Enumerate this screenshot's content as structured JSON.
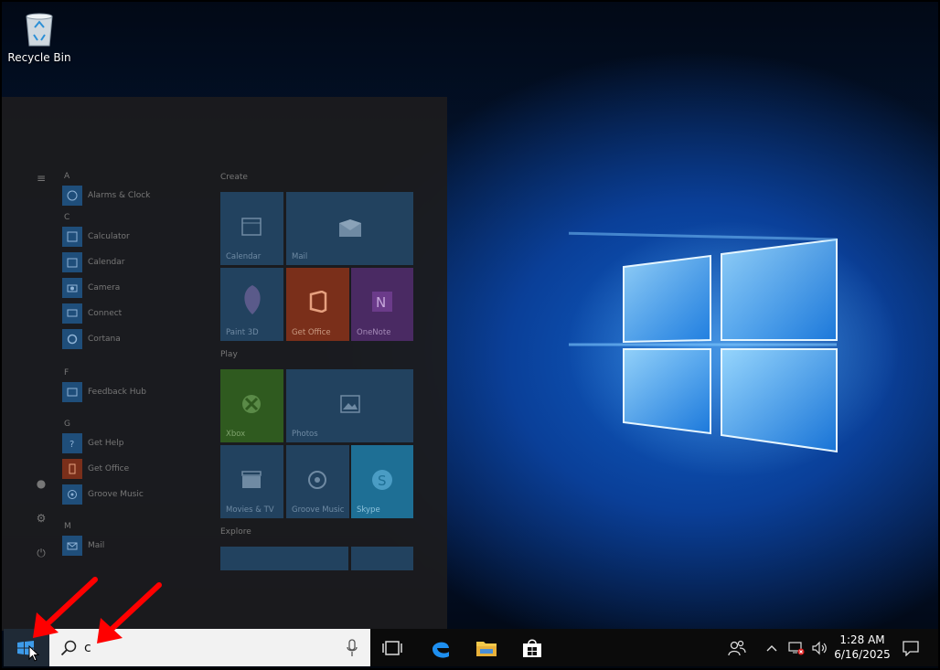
{
  "desktop": {
    "recycle_bin_label": "Recycle Bin"
  },
  "start_menu": {
    "letters": [
      "A",
      "C",
      "F",
      "G",
      "M"
    ],
    "apps": [
      {
        "letter": "A",
        "label": "Alarms & Clock",
        "icon": "alarm-clock-icon"
      },
      {
        "letter": "C",
        "label": "Calculator",
        "icon": "calculator-icon"
      },
      {
        "letter": "C",
        "label": "Calendar",
        "icon": "calendar-icon"
      },
      {
        "letter": "C",
        "label": "Camera",
        "icon": "camera-icon"
      },
      {
        "letter": "C",
        "label": "Connect",
        "icon": "connect-icon"
      },
      {
        "letter": "C",
        "label": "Cortana",
        "icon": "cortana-icon"
      },
      {
        "letter": "F",
        "label": "Feedback Hub",
        "icon": "feedback-icon"
      },
      {
        "letter": "G",
        "label": "Get Help",
        "icon": "help-icon"
      },
      {
        "letter": "G",
        "label": "Get Office",
        "icon": "office-icon"
      },
      {
        "letter": "G",
        "label": "Groove Music",
        "icon": "groove-icon"
      },
      {
        "letter": "M",
        "label": "Mail",
        "icon": "mail-icon"
      }
    ],
    "sections": {
      "create": "Create",
      "play": "Play",
      "explore": "Explore"
    },
    "tiles": {
      "calendar": "Calendar",
      "mail": "Mail",
      "paint3d": "Paint 3D",
      "get_office": "Get Office",
      "onenote": "OneNote",
      "xbox": "Xbox",
      "photos": "Photos",
      "movies": "Movies & TV",
      "groove": "Groove Music",
      "skype": "Skype"
    }
  },
  "taskbar": {
    "search_value": "c",
    "time": "1:28 AM",
    "date": "6/16/2025"
  },
  "colors": {
    "start_menu_bg": "#1c1c1e",
    "tile_blue": "#22425f",
    "office_tile": "#7a2f1a",
    "onenote_tile": "#4a2a63",
    "xbox_tile": "#2f5a1f",
    "skype_tile": "#1e6f95",
    "annotation_arrow": "#ff0000"
  }
}
